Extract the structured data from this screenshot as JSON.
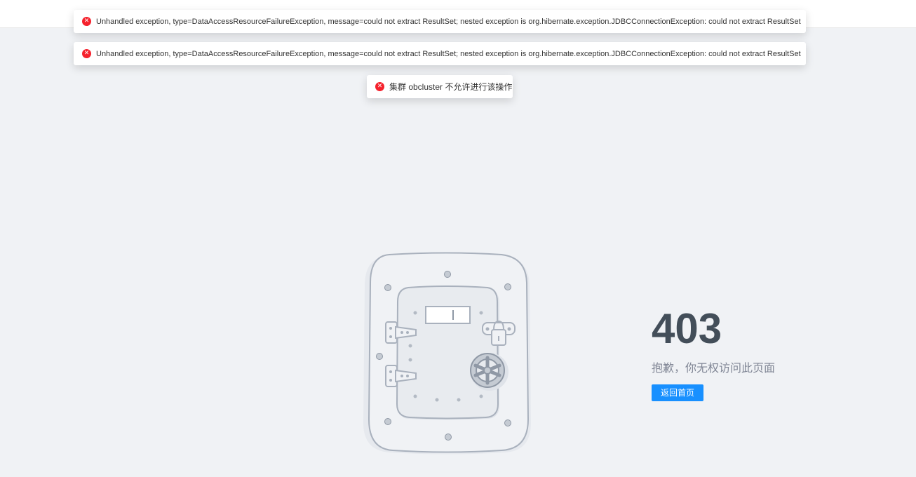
{
  "notifications": [
    {
      "icon": "error-icon",
      "text": "Unhandled exception, type=DataAccessResourceFailureException, message=could not extract ResultSet; nested exception is org.hibernate.exception.JDBCConnectionException: could not extract ResultSet"
    },
    {
      "icon": "error-icon",
      "text": "Unhandled exception, type=DataAccessResourceFailureException, message=could not extract ResultSet; nested exception is org.hibernate.exception.JDBCConnectionException: could not extract ResultSet"
    },
    {
      "icon": "error-icon",
      "text": "集群 obcluster 不允许进行该操作"
    }
  ],
  "error_page": {
    "code": "403",
    "message": "抱歉，你无权访问此页面",
    "back_button_label": "返回首页"
  },
  "colors": {
    "error": "#f5222d",
    "primary": "#1890ff",
    "code_text": "#434e59",
    "background": "#f0f2f5"
  }
}
